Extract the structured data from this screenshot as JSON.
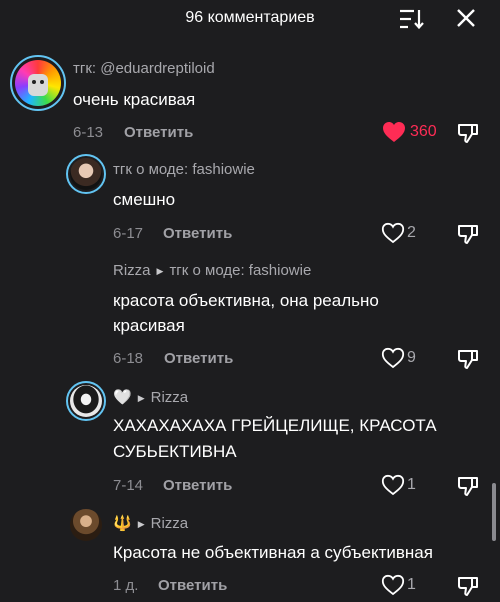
{
  "header": {
    "title": "96 комментариев",
    "sort_icon": "sort-descending-icon",
    "close_icon": "close-icon"
  },
  "colors": {
    "background": "#1d1d1f",
    "like_active": "#fe2c55",
    "story_ring": "#62c4f2",
    "muted_text": "#a8a8ad"
  },
  "comments": [
    {
      "author": "тгк: @eduardreptiloid",
      "text": "очень красивая",
      "date": "6-13",
      "reply_label": "Ответить",
      "likes": "360",
      "liked": true
    },
    {
      "author": "тгк о моде: fashiowie",
      "text": "смешно",
      "date": "6-17",
      "reply_label": "Ответить",
      "likes": "2"
    },
    {
      "author": "Rizza",
      "reply_to": "тгк о моде: fashiowie",
      "text_line1": "красота объективна, она реально",
      "text_line2": "красивая",
      "date": "6-18",
      "reply_label": "Ответить",
      "likes": "9"
    },
    {
      "author": "🤍",
      "reply_to": "Rizza",
      "text_line1": "ХАХАХАХАХА ГРЕЙЦЕЛИЩЕ, КРАСОТА",
      "text_line2": "СУБЬЕКТИВНА",
      "date": "7-14",
      "reply_label": "Ответить",
      "likes": "1"
    },
    {
      "author": "🔱",
      "reply_to": "Rizza",
      "text": "Красота не объективная а субъективная",
      "date": "1 д.",
      "reply_label": "Ответить",
      "likes": "1"
    }
  ]
}
